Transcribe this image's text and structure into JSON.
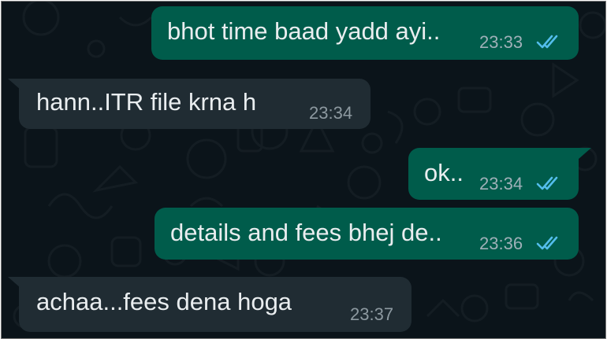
{
  "chat": {
    "messages": [
      {
        "direction": "outgoing",
        "text": "bhot time baad yadd ayi..",
        "time": "23:33",
        "status": "read-double-tick-icon"
      },
      {
        "direction": "incoming",
        "text": "hann..ITR file krna h",
        "time": "23:34"
      },
      {
        "direction": "outgoing",
        "text": "ok..",
        "time": "23:34",
        "status": "read-double-tick-icon"
      },
      {
        "direction": "outgoing",
        "text": "details and fees bhej de..",
        "time": "23:36",
        "status": "read-double-tick-icon"
      },
      {
        "direction": "incoming",
        "text": "achaa...fees dena hoga",
        "time": "23:37"
      }
    ]
  },
  "colors": {
    "background": "#0b141a",
    "outgoing_bubble": "#005c4b",
    "incoming_bubble": "#202c33",
    "read_ticks": "#53bdeb",
    "text": "#e9edef"
  }
}
